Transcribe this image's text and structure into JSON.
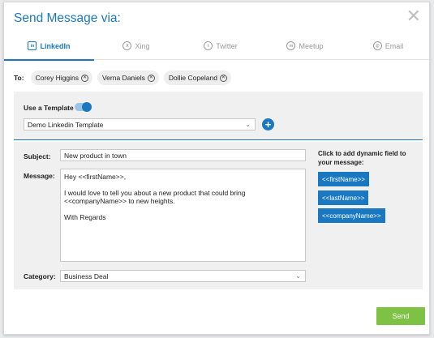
{
  "dialog": {
    "title": "Send Message via:",
    "close": "✕"
  },
  "tabs": [
    {
      "label": "LinkedIn",
      "icon": "in",
      "active": true
    },
    {
      "label": "Xing",
      "icon": "X"
    },
    {
      "label": "Twitter",
      "icon": "t"
    },
    {
      "label": "Meetup",
      "icon": "m"
    },
    {
      "label": "Email",
      "icon": "@"
    }
  ],
  "recipients": {
    "label": "To:",
    "chips": [
      "Corey Higgins",
      "Verna Daniels",
      "Dollie Copeland"
    ]
  },
  "template": {
    "label": "Use a Template",
    "enabled": true,
    "selected": "Demo Linkedin Template",
    "add": "+"
  },
  "form": {
    "subject_label": "Subject:",
    "subject_value": "New product in town",
    "message_label": "Message:",
    "message_lines": [
      "Hey <<firstName>>,",
      "I would love to tell you about a new product that could bring <<companyName>> to new heights.",
      "With Regards"
    ],
    "category_label": "Category:",
    "category_value": "Business Deal"
  },
  "dynamic": {
    "heading": "Click to add dynamic field to your message:",
    "fields": [
      "<<firstName>>",
      "<<lastName>>",
      "<<companyName>>"
    ]
  },
  "actions": {
    "send_label": "Send"
  },
  "colors": {
    "primary": "#1a78c2",
    "send": "#7dc242",
    "panel": "#f0f0f0"
  }
}
